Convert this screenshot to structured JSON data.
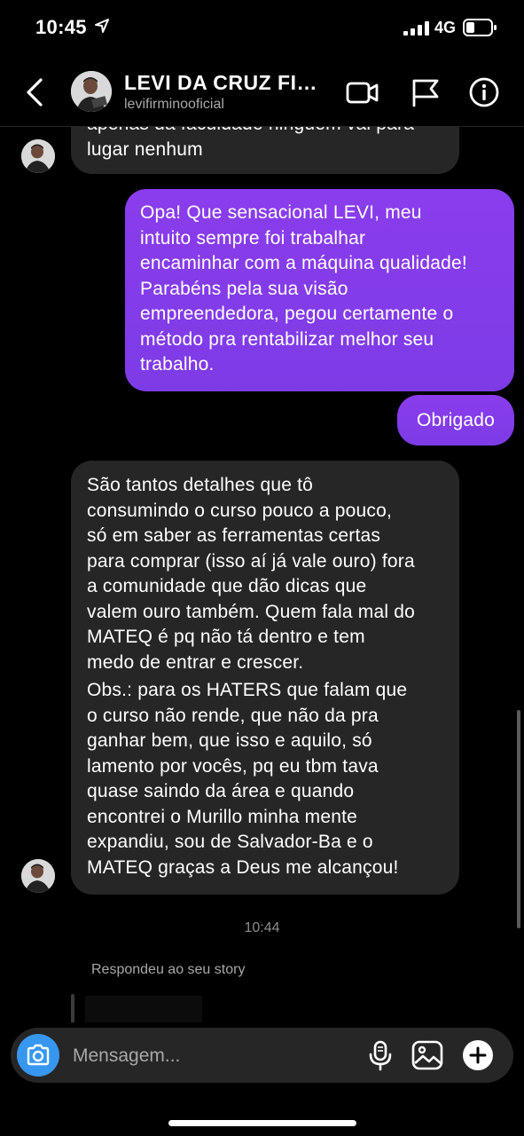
{
  "status_bar": {
    "time": "10:45",
    "network": "4G"
  },
  "header": {
    "name": "LEVI DA CRUZ FIRMINO",
    "username": "levifirminooficial",
    "icons": [
      "back-icon",
      "video-call-icon",
      "flag-icon",
      "info-icon"
    ]
  },
  "messages": {
    "msg1_line1": "apenas da faculdade ninguém vai para",
    "msg1_line2": "lugar nenhum",
    "msg2_lines": [
      "Opa! Que sensacional LEVI, meu",
      "intuito sempre foi trabalhar",
      "encaminhar com a máquina qualidade!",
      "Parabéns pela sua visão",
      "empreendedora, pegou certamente o",
      "método pra rentabilizar melhor seu",
      "trabalho."
    ],
    "msg3": "Obrigado",
    "msg4_lines": [
      "São tantos detalhes que tô",
      "consumindo o curso pouco a pouco,",
      "só em saber as ferramentas certas",
      "para comprar (isso aí já vale ouro) fora",
      "a comunidade que dão dicas que",
      "valem ouro também. Quem fala mal do",
      "MATEQ é pq não tá dentro e tem",
      "medo de entrar e crescer."
    ],
    "msg4b_lines": [
      "Obs.: para os HATERS que falam que",
      "o curso não rende, que não da pra",
      "ganhar bem, que isso e aquilo, só",
      "lamento por vocês, pq eu tbm tava",
      "quase saindo da área e quando",
      "encontrei o Murillo minha mente",
      "expandiu, sou de Salvador-Ba e o",
      "MATEQ graças a Deus me alcançou!"
    ],
    "timestamp": "10:44",
    "replied_story": "Respondeu ao seu story"
  },
  "composer": {
    "placeholder": "Mensagem...",
    "icons": [
      "camera-icon",
      "microphone-icon",
      "gallery-icon",
      "add-icon"
    ]
  },
  "colors": {
    "background": "#000000",
    "incoming_bubble": "#262626",
    "outgoing_bubble": "#8a3ded",
    "camera_button": "#3797f0",
    "secondary_text": "#a8a8a8"
  }
}
